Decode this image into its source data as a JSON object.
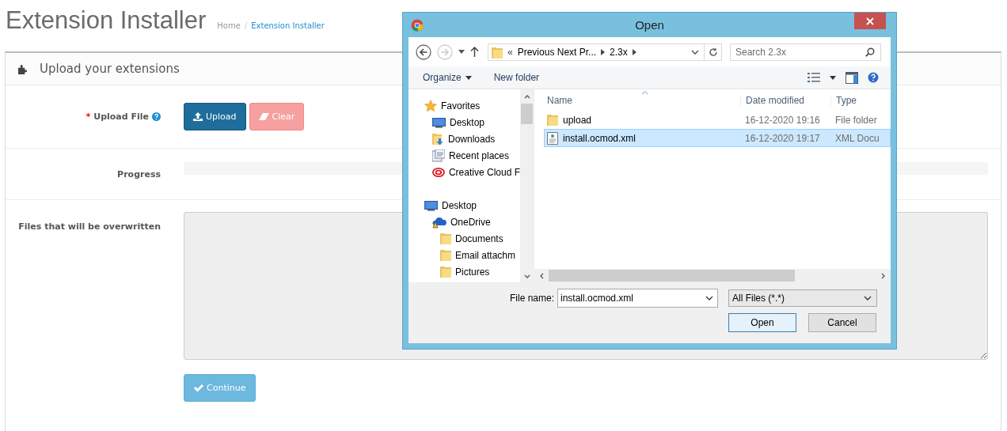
{
  "page": {
    "title": "Extension Installer",
    "breadcrumb_separator": "/",
    "breadcrumb": [
      {
        "label": "Home",
        "selected": false
      },
      {
        "label": "Extension Installer",
        "selected": true
      }
    ],
    "panel": {
      "heading": "Upload your extensions",
      "upload": {
        "label": "Upload File",
        "required_mark": "*",
        "buttons": [
          {
            "label": "Upload",
            "kind": "upload",
            "disabled": false
          },
          {
            "label": "Clear",
            "kind": "clear",
            "disabled": true
          }
        ]
      },
      "progress": {
        "label": "Progress",
        "level": 0
      },
      "overwrite": {
        "label": "Files that will be overwritten"
      },
      "continue": {
        "label": "Continue",
        "disabled": true
      }
    }
  },
  "dialog": {
    "title": "Open",
    "address": {
      "overflow": "«",
      "crumbs": [
        "Previous Next Pr...",
        "2.3x"
      ]
    },
    "search": {
      "placeholder": "Search 2.3x"
    },
    "toolbar": [
      {
        "label": "Organize",
        "menu": true
      },
      {
        "label": "New folder",
        "menu": false
      }
    ],
    "nav": [
      {
        "label": "Favorites",
        "kind": "star",
        "children": [
          {
            "label": "Desktop",
            "kind": "monitor"
          },
          {
            "label": "Downloads",
            "kind": "downloads"
          },
          {
            "label": "Recent places",
            "kind": "recent"
          },
          {
            "label": "Creative Cloud F",
            "kind": "creative"
          }
        ]
      },
      {
        "label": "Desktop",
        "kind": "monitor",
        "children": [
          {
            "label": "OneDrive",
            "kind": "cloud",
            "children": [
              {
                "label": "Documents",
                "kind": "folder"
              },
              {
                "label": "Email attachm",
                "kind": "folder"
              },
              {
                "label": "Pictures",
                "kind": "folder"
              }
            ]
          }
        ]
      }
    ],
    "columns": [
      "Name",
      "Date modified",
      "Type"
    ],
    "files": [
      {
        "name": "upload",
        "date": "16-12-2020 19:16",
        "type": "File folder",
        "kind": "folder",
        "selected": false
      },
      {
        "name": "install.ocmod.xml",
        "date": "16-12-2020 19:17",
        "type": "XML Docu",
        "kind": "xml",
        "selected": true
      }
    ],
    "file_name": {
      "label": "File name:",
      "value": "install.ocmod.xml"
    },
    "filter": {
      "value": "All Files (*.*)"
    },
    "buttons": [
      {
        "label": "Open",
        "default": true
      },
      {
        "label": "Cancel",
        "default": false
      }
    ]
  }
}
